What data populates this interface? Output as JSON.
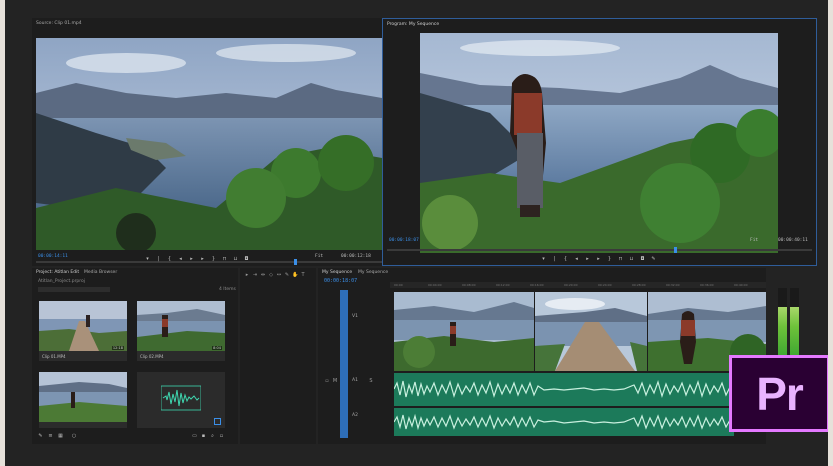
{
  "source_monitor": {
    "title": "Source: Clip 01.mp4",
    "timecode_in": "00:00:14:11",
    "fit": "Fit",
    "timecode_out": "00:00:12:18"
  },
  "program_monitor": {
    "title": "Program: My Sequence",
    "timecode_in": "00:00:18:07",
    "fit": "Fit",
    "timecode_out": "00:00:40:11"
  },
  "project_panel": {
    "tabs": [
      "Project: Atitlan Edit",
      "Media Browser"
    ],
    "search_placeholder": "Atitlan_Project.prproj",
    "item_count": "4 Items",
    "clips": [
      {
        "label": "Clip 01.MP4",
        "duration": "12:18"
      },
      {
        "label": "Clip 02.MP4",
        "duration": "8:04"
      },
      {
        "label": "",
        "duration": ""
      },
      {
        "label": "",
        "duration": ""
      }
    ]
  },
  "timeline": {
    "tabs": [
      "My Sequence",
      "My Sequence 2"
    ],
    "timecode": "00:00:18:07",
    "video_track": "V1",
    "audio_tracks": [
      "A1",
      "A2"
    ],
    "ruler_ticks": [
      "00:00",
      "00:04:00",
      "00:08:00",
      "00:12:00",
      "00:16:00",
      "00:20:00",
      "00:24:00",
      "00:28:00",
      "00:32:00",
      "00:36:00",
      "00:40:00"
    ]
  },
  "audio_meter": {
    "left_level": 0.72,
    "right_level": 0.72,
    "color": "#6ec23a"
  },
  "logo": {
    "text": "Pr",
    "border_color": "#e479ff",
    "bg_color": "#2a0033"
  },
  "colors": {
    "accent": "#3b8fe8",
    "audio_clip": "#1c7a5a"
  },
  "icons": [
    "play-icon",
    "step-back-icon",
    "step-forward-icon",
    "mark-in-icon",
    "mark-out-icon",
    "camera-icon",
    "settings-icon",
    "razor-icon",
    "selection-icon",
    "pen-icon"
  ]
}
